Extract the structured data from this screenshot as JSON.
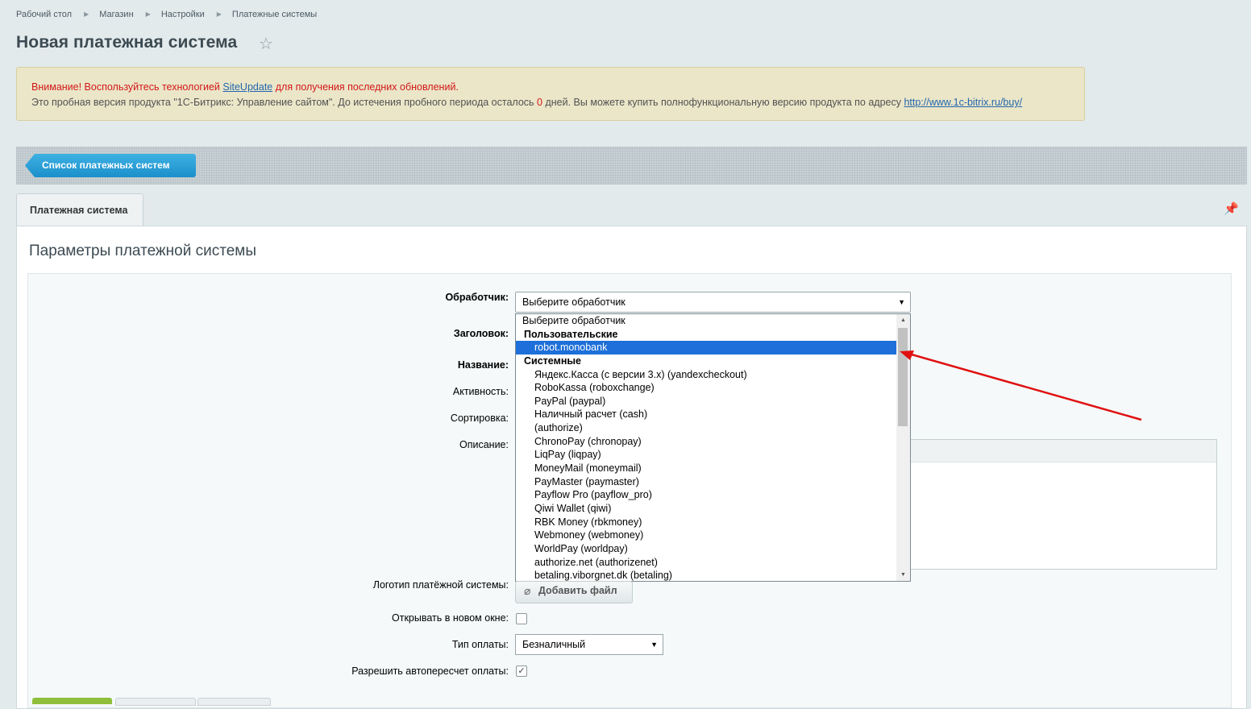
{
  "breadcrumb": [
    "Рабочий стол",
    "Магазин",
    "Настройки",
    "Платежные системы"
  ],
  "page": {
    "title": "Новая платежная система"
  },
  "notice": {
    "line1_warn": "Внимание! Воспользуйтесь технологией",
    "line1_link": "SiteUpdate",
    "line1_tail": "для получения последних обновлений.",
    "line2_text": "Это пробная версия продукта \"1С-Битрикс: Управление сайтом\". До истечения пробного периода осталось",
    "line2_days": "0",
    "line2_tail": "дней. Вы можете купить полнофункциональную версию продукта по адресу",
    "line2_link": "http://www.1c-bitrix.ru/buy/"
  },
  "toolbar": {
    "list_button": "Список платежных систем"
  },
  "tabs": [
    {
      "label": "Платежная система"
    }
  ],
  "section": {
    "title": "Параметры платежной системы"
  },
  "form": {
    "handler_label": "Обработчик:",
    "handler_value": "Выберите обработчик",
    "header_label": "Заголовок:",
    "name_label": "Название:",
    "active_label": "Активность:",
    "sort_label": "Сортировка:",
    "description_label": "Описание:",
    "logo_label": "Логотип платёжной системы:",
    "add_file_label": "Добавить файл",
    "new_window_label": "Открывать в новом окне:",
    "pay_type_label": "Тип оплаты:",
    "pay_type_value": "Безналичный",
    "auto_recalc_label": "Разрешить автопересчет оплаты:",
    "new_window_checked": false,
    "auto_recalc_checked": true
  },
  "dropdown": {
    "placeholder": "Выберите обработчик",
    "group_custom": "Пользовательские",
    "custom_items": [
      "robot.monobank"
    ],
    "group_system": "Системные",
    "system_items": [
      "Яндекс.Касса (с версии 3.x) (yandexcheckout)",
      "RoboKassa (roboxchange)",
      "PayPal (paypal)",
      "Наличный расчет (cash)",
      "(authorize)",
      "ChronoPay (chronopay)",
      "LiqPay (liqpay)",
      "MoneyMail (moneymail)",
      "PayMaster (paymaster)",
      "Payflow Pro (payflow_pro)",
      "Qiwi Wallet (qiwi)",
      "RBK Money (rbkmoney)",
      "Webmoney (webmoney)",
      "WorldPay (worldpay)",
      "authorize.net (authorizenet)",
      "betaling.viborgnet.dk (betaling)"
    ],
    "selected": "robot.monobank"
  },
  "icons": {
    "star": "star-icon",
    "pin": "pin-icon",
    "paperclip": "paperclip-icon",
    "arrow": "red-annotation-arrow"
  },
  "colors": {
    "accent": "#1b8fcb",
    "warning": "#d21818",
    "selection": "#1e6fd9",
    "annotation": "#e01010"
  }
}
